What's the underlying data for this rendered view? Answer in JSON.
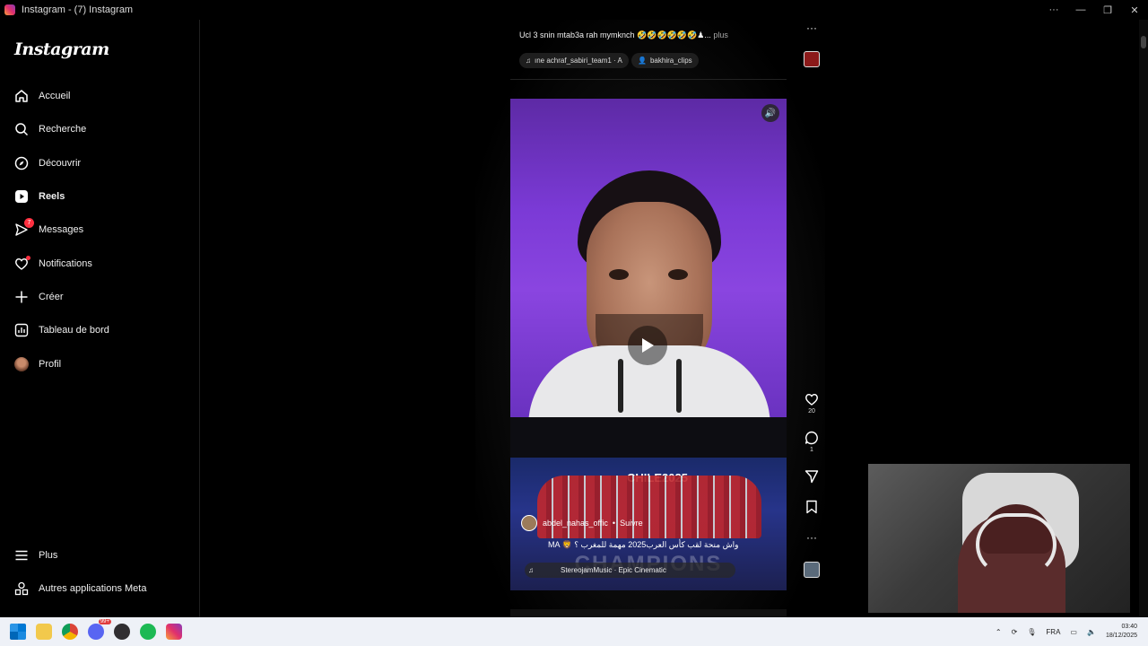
{
  "window": {
    "title": "Instagram - (7) Instagram"
  },
  "sidebar": {
    "logo": "Instagram",
    "items": [
      {
        "label": "Accueil",
        "icon": "home-icon"
      },
      {
        "label": "Recherche",
        "icon": "search-icon"
      },
      {
        "label": "Découvrir",
        "icon": "compass-icon"
      },
      {
        "label": "Reels",
        "icon": "reels-icon"
      },
      {
        "label": "Messages",
        "icon": "messenger-icon",
        "badge": "7"
      },
      {
        "label": "Notifications",
        "icon": "heart-icon"
      },
      {
        "label": "Créer",
        "icon": "plus-icon"
      },
      {
        "label": "Tableau de bord",
        "icon": "dashboard-icon"
      },
      {
        "label": "Profil",
        "icon": "avatar"
      }
    ],
    "bottom": [
      {
        "label": "Plus",
        "icon": "menu-icon"
      },
      {
        "label": "Autres applications Meta",
        "icon": "meta-apps-icon"
      }
    ]
  },
  "previous_post": {
    "caption": "Ucl 3 snin mtab3a rah mymknch 🤣🤣🤣🤣🤣🤣♟...",
    "more": "plus",
    "audio": "ıne  achraf_sabiri_team1 · A",
    "tag": "bakhira_clips"
  },
  "reel": {
    "username": "abdel_nahas_offic",
    "follow": "Suivre",
    "caption": "MA 🦁 واش منحة لقب كأس العرب2025 مهمة للمغرب ؟",
    "audio": "StereojamMusic · Epic Cinematic",
    "banner": "CHILE2025",
    "champions": "CHAMPIONS",
    "likes": "20",
    "comments": "1"
  },
  "taskbar": {
    "lang": "FRA",
    "time": "03:40",
    "date": "18/12/2025",
    "discord_badge": "99+"
  },
  "colors": {
    "accent_red": "#ff3040",
    "reel_purple": "#7b3ad6"
  }
}
